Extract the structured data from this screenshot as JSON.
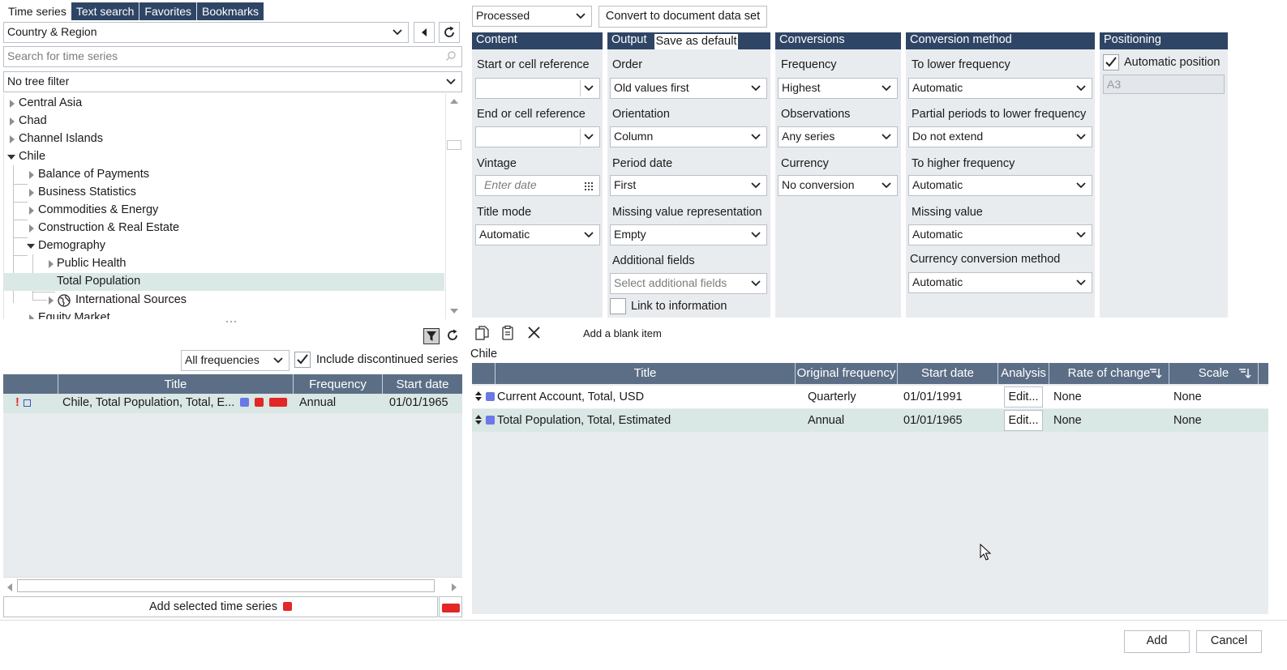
{
  "tabs": [
    "Time series",
    "Text search",
    "Favorites",
    "Bookmarks"
  ],
  "left": {
    "region_select": "Country & Region",
    "search_placeholder": "Search for time series",
    "tree_filter": "No tree filter",
    "tree": [
      {
        "label": "Central Asia"
      },
      {
        "label": "Chad"
      },
      {
        "label": "Channel Islands"
      },
      {
        "label": "Chile"
      },
      {
        "label": "Balance of Payments"
      },
      {
        "label": "Business Statistics"
      },
      {
        "label": "Commodities & Energy"
      },
      {
        "label": "Construction & Real Estate"
      },
      {
        "label": "Demography"
      },
      {
        "label": "Public Health"
      },
      {
        "label": "Total Population"
      },
      {
        "label": "International Sources"
      },
      {
        "label": "Equity Market"
      }
    ],
    "frequency_filter": "All frequencies",
    "include_discontinued_label": "Include discontinued series",
    "columns": [
      "Title",
      "Frequency",
      "Start date"
    ],
    "rows": [
      {
        "flag": "!",
        "title": "Chile, Total Population, Total, E...",
        "frequency": "Annual",
        "start_date": "01/01/1965"
      }
    ],
    "add_selected_label": "Add selected time series"
  },
  "top": {
    "mode_select": "Processed",
    "convert_button": "Convert to document data set"
  },
  "content_panel": {
    "header": "Content",
    "start_label": "Start or cell reference",
    "start_value": "",
    "end_label": "End or cell reference",
    "end_value": "",
    "vintage_label": "Vintage",
    "vintage_placeholder": "Enter date",
    "title_mode_label": "Title mode",
    "title_mode_value": "Automatic"
  },
  "output_panel": {
    "header": "Output",
    "save_default": "Save as default",
    "order_label": "Order",
    "order_value": "Old values first",
    "orientation_label": "Orientation",
    "orientation_value": "Column",
    "period_date_label": "Period date",
    "period_date_value": "First",
    "missing_label": "Missing value representation",
    "missing_value": "Empty",
    "additional_label": "Additional fields",
    "additional_placeholder": "Select additional fields",
    "link_label": "Link to information"
  },
  "conversions_panel": {
    "header": "Conversions",
    "frequency_label": "Frequency",
    "frequency_value": "Highest",
    "observations_label": "Observations",
    "observations_value": "Any series",
    "currency_label": "Currency",
    "currency_value": "No conversion"
  },
  "method_panel": {
    "header": "Conversion method",
    "lower_label": "To lower frequency",
    "lower_value": "Automatic",
    "partial_label": "Partial periods to lower frequency",
    "partial_value": "Do not extend",
    "higher_label": "To higher frequency",
    "higher_value": "Automatic",
    "missing_label": "Missing value",
    "missing_value": "Automatic",
    "currency_method_label": "Currency conversion method",
    "currency_method_value": "Automatic"
  },
  "positioning_panel": {
    "header": "Positioning",
    "auto_label": "Automatic position",
    "cell_value": "A3"
  },
  "right": {
    "add_blank_label": "Add a blank item",
    "group_label": "Chile",
    "columns": [
      "Title",
      "Original frequency",
      "Start date",
      "Analysis",
      "Rate of change",
      "Scale"
    ],
    "rows": [
      {
        "title": "Current Account, Total, USD",
        "frequency": "Quarterly",
        "start_date": "01/01/1991",
        "analysis": "Edit...",
        "rate": "None",
        "scale": "None"
      },
      {
        "title": "Total Population, Total, Estimated",
        "frequency": "Annual",
        "start_date": "01/01/1965",
        "analysis": "Edit...",
        "rate": "None",
        "scale": "None"
      }
    ]
  },
  "footer": {
    "add_button": "Add",
    "cancel_button": "Cancel"
  },
  "colors": {
    "header_navy": "#2f4565",
    "grid_header": "#5b6e86",
    "panel_bg": "#e9ecef",
    "selected_row": "#d9e7e5",
    "badge_red": "#e32626",
    "badge_blue": "#6b78e6"
  }
}
